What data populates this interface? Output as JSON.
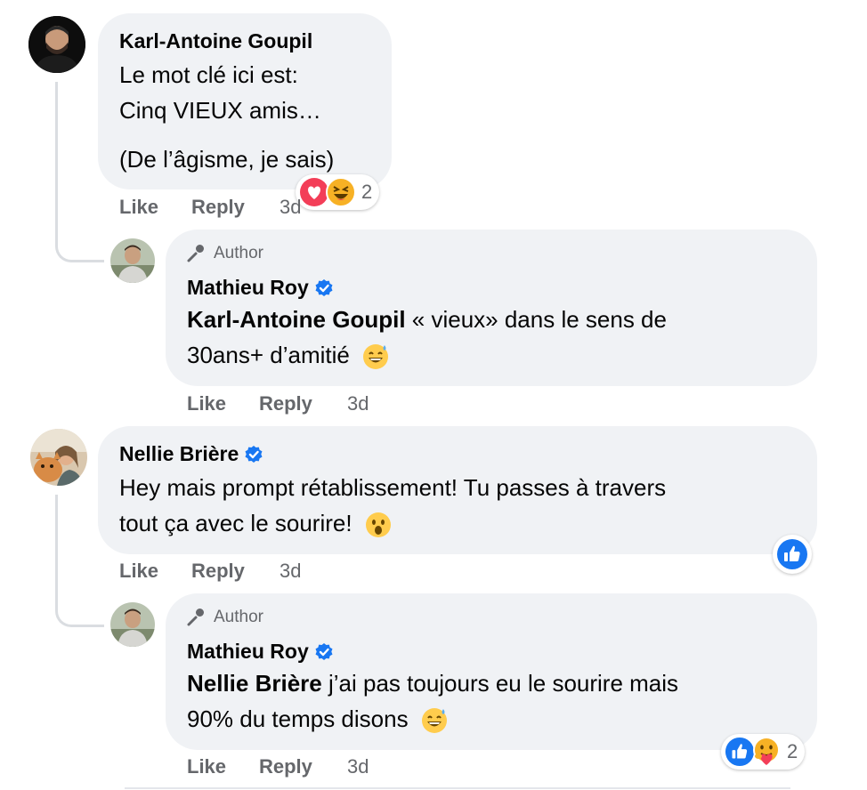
{
  "comments": [
    {
      "author": "Karl-Antoine Goupil",
      "lines": [
        "Le mot clé ici est:",
        "Cinq VIEUX amis…",
        "(De l’âgisme, je sais)"
      ],
      "actions": {
        "like": "Like",
        "reply": "Reply",
        "time": "3d"
      },
      "reactions": {
        "count": "2",
        "types": [
          "love",
          "haha"
        ]
      }
    },
    {
      "author_label": "Author",
      "author": "Mathieu Roy",
      "mention": "Karl-Antoine Goupil",
      "line1_rest": " « vieux» dans le sens de",
      "line2": "30ans+ d’amitié",
      "actions": {
        "like": "Like",
        "reply": "Reply",
        "time": "3d"
      }
    },
    {
      "author": "Nellie Brière",
      "lines": [
        "Hey mais prompt rétablissement! Tu passes à travers",
        "tout ça avec le sourire!"
      ],
      "actions": {
        "like": "Like",
        "reply": "Reply",
        "time": "3d"
      },
      "reactions": {
        "types": [
          "like"
        ]
      }
    },
    {
      "author_label": "Author",
      "author": "Mathieu Roy",
      "mention": "Nellie Brière",
      "line1_rest": " j’ai pas toujours eu le sourire mais",
      "line2": "90% du temps disons",
      "actions": {
        "like": "Like",
        "reply": "Reply",
        "time": "3d"
      },
      "reactions": {
        "count": "2",
        "types": [
          "like",
          "care"
        ]
      }
    }
  ],
  "colors": {
    "bubble": "#f0f2f5",
    "muted": "#65676b",
    "verified": "#1877f2",
    "love": "#f33e58",
    "like": "#1877f2",
    "haha": "#f7b125"
  }
}
